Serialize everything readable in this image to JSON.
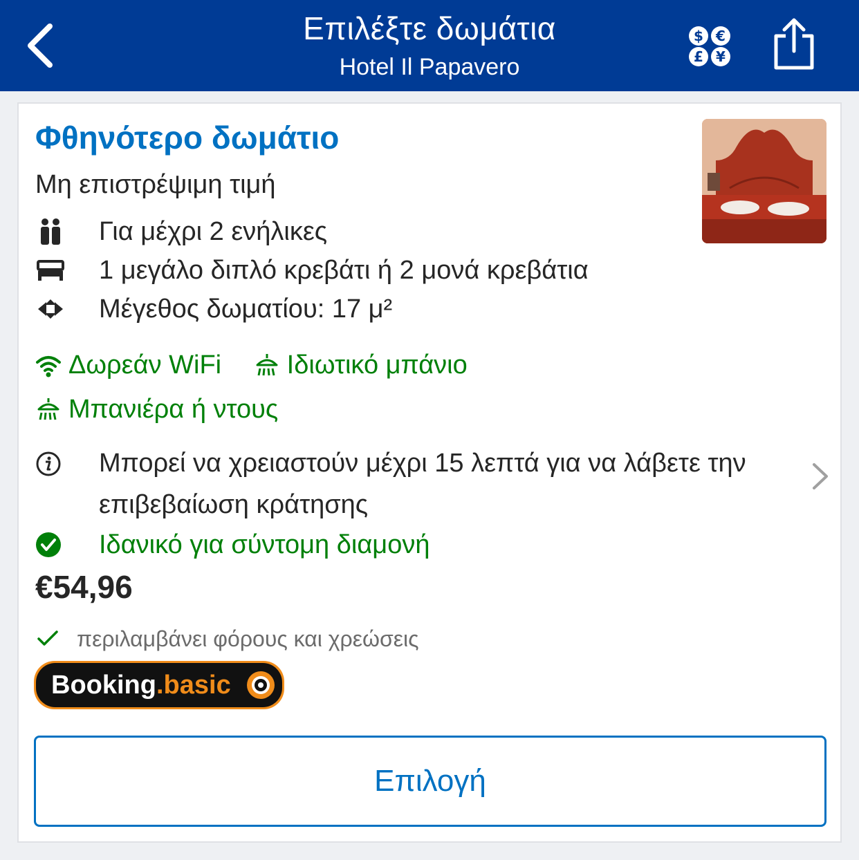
{
  "header": {
    "title": "Επιλέξτε δωμάτια",
    "subtitle": "Hotel Il Papavero",
    "back_icon": "chevron-left-icon",
    "currency_icon": "currency-icon",
    "share_icon": "share-icon",
    "bg_color": "#003b95"
  },
  "room": {
    "title": "Φθηνότερο δωμάτιο",
    "refund_policy": "Μη επιστρέψιμη τιμή",
    "features": [
      {
        "icon": "guests-icon",
        "text": "Για μέχρι 2 ενήλικες"
      },
      {
        "icon": "bed-icon",
        "text": "1 μεγάλο διπλό κρεβάτι ή 2 μονά κρεβάτια"
      },
      {
        "icon": "room-size-icon",
        "text": "Μέγεθος δωματίου: 17 μ²"
      }
    ],
    "amenities": [
      {
        "icon": "wifi-icon",
        "text": "Δωρεάν WiFi"
      },
      {
        "icon": "shower-icon",
        "text": "Ιδιωτικό μπάνιο"
      },
      {
        "icon": "shower-icon",
        "text": "Μπανιέρα ή ντους"
      }
    ],
    "info_text": "Μπορεί να χρειαστούν μέχρι 15 λεπτά για να λάβετε την επιβεβαίωση κράτησης",
    "good_for": "Ιδανικό για σύντομη διαμονή",
    "price": "€54,96",
    "taxes_note": "περιλαμβάνει φόρους και χρεώσεις",
    "badge": {
      "brand": "Booking",
      "suffix": ".basic"
    },
    "select_label": "Επιλογή"
  },
  "colors": {
    "link_blue": "#0071c2",
    "green": "#008009",
    "badge_orange": "#f08c1a"
  }
}
